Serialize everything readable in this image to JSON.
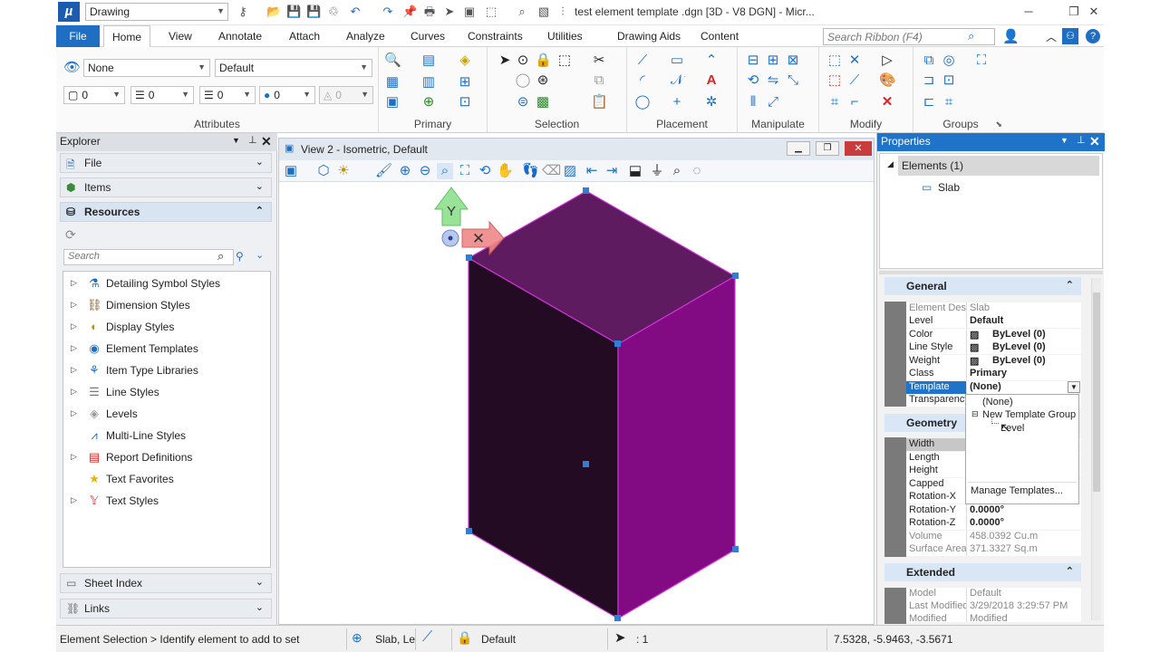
{
  "app": {
    "workspace": "Drawing",
    "window_title": "test element template .dgn [3D - V8 DGN] - Micr..."
  },
  "ribbon_tabs": [
    "File",
    "Home",
    "View",
    "Annotate",
    "Attach",
    "Analyze",
    "Curves",
    "Constraints",
    "Utilities",
    "Drawing Aids",
    "Content"
  ],
  "search_ribbon_placeholder": "Search Ribbon (F4)",
  "attributes": {
    "style1": "None",
    "style2": "Default",
    "v1": "0",
    "v2": "0",
    "v3": "0",
    "v4": "0",
    "v5": "0"
  },
  "ribbon_groups": [
    "Attributes",
    "Primary",
    "Selection",
    "Placement",
    "Manipulate",
    "Modify",
    "Groups"
  ],
  "explorer": {
    "title": "Explorer",
    "sections": [
      "File",
      "Items",
      "Resources"
    ],
    "search_placeholder": "Search",
    "tree": [
      "Detailing Symbol Styles",
      "Dimension Styles",
      "Display Styles",
      "Element Templates",
      "Item Type Libraries",
      "Line Styles",
      "Levels",
      "Multi-Line Styles",
      "Report Definitions",
      "Text Favorites",
      "Text Styles"
    ],
    "bottom_sections": [
      "Sheet Index",
      "Links"
    ]
  },
  "view": {
    "title": "View 2 - Isometric, Default",
    "axis_label": "Y"
  },
  "properties": {
    "title": "Properties",
    "root": "Elements (1)",
    "child": "Slab",
    "general_title": "General",
    "general": [
      [
        "Element Desc",
        "Slab"
      ],
      [
        "Level",
        "Default"
      ],
      [
        "Color",
        "ByLevel (0)"
      ],
      [
        "Line Style",
        "ByLevel (0)"
      ],
      [
        "Weight",
        "ByLevel (0)"
      ],
      [
        "Class",
        "Primary"
      ],
      [
        "Template",
        "(None)"
      ],
      [
        "Transparency",
        ""
      ]
    ],
    "geometry_title": "Geometry",
    "geometry": [
      [
        "Width",
        ""
      ],
      [
        "Length",
        ""
      ],
      [
        "Height",
        ""
      ],
      [
        "Capped",
        ""
      ],
      [
        "Rotation-X",
        ""
      ],
      [
        "Rotation-Y",
        "0.0000°"
      ],
      [
        "Rotation-Z",
        "0.0000°"
      ],
      [
        "Volume",
        "458.0392 Cu.m"
      ],
      [
        "Surface Area",
        "371.3327 Sq.m"
      ]
    ],
    "extended_title": "Extended",
    "extended": [
      [
        "Model",
        "Default"
      ],
      [
        "Last Modified",
        "3/29/2018 3:29:57 PM"
      ],
      [
        "Modified",
        "Modified"
      ]
    ],
    "template_options": [
      "(None)",
      "New Template Group",
      "Level"
    ],
    "manage_templates": "Manage Templates..."
  },
  "status": {
    "prompt": "Element Selection > Identify element to add to set",
    "slab": "Slab, Le",
    "level": "Default",
    "count": ": 1",
    "coords": "7.5328, -5.9463, -3.5671"
  }
}
